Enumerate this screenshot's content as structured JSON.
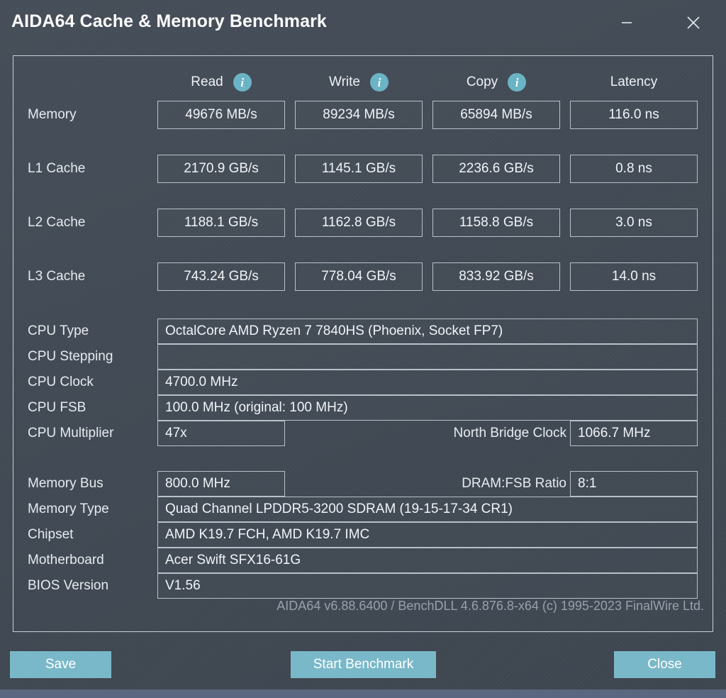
{
  "window": {
    "title": "AIDA64 Cache & Memory Benchmark",
    "minimize_label": "minimize",
    "close_label": "close"
  },
  "benchmark": {
    "columns": [
      {
        "label": "Read",
        "has_info": true
      },
      {
        "label": "Write",
        "has_info": true
      },
      {
        "label": "Copy",
        "has_info": true
      },
      {
        "label": "Latency",
        "has_info": false
      }
    ],
    "info_glyph": "i",
    "rows": [
      {
        "label": "Memory",
        "read": "49676 MB/s",
        "write": "89234 MB/s",
        "copy": "65894 MB/s",
        "latency": "116.0 ns"
      },
      {
        "label": "L1 Cache",
        "read": "2170.9 GB/s",
        "write": "1145.1 GB/s",
        "copy": "2236.6 GB/s",
        "latency": "0.8 ns"
      },
      {
        "label": "L2 Cache",
        "read": "1188.1 GB/s",
        "write": "1162.8 GB/s",
        "copy": "1158.8 GB/s",
        "latency": "3.0 ns"
      },
      {
        "label": "L3 Cache",
        "read": "743.24 GB/s",
        "write": "778.04 GB/s",
        "copy": "833.92 GB/s",
        "latency": "14.0 ns"
      }
    ]
  },
  "cpu_info": {
    "cpu_type_label": "CPU Type",
    "cpu_type_value": "OctalCore AMD Ryzen 7 7840HS  (Phoenix, Socket FP7)",
    "cpu_stepping_label": "CPU Stepping",
    "cpu_stepping_value": "",
    "cpu_clock_label": "CPU Clock",
    "cpu_clock_value": "4700.0 MHz",
    "cpu_fsb_label": "CPU FSB",
    "cpu_fsb_value": "100.0 MHz  (original: 100 MHz)",
    "cpu_multiplier_label": "CPU Multiplier",
    "cpu_multiplier_value": "47x",
    "north_bridge_label": "North Bridge Clock",
    "north_bridge_value": "1066.7 MHz"
  },
  "memory_info": {
    "memory_bus_label": "Memory Bus",
    "memory_bus_value": "800.0 MHz",
    "dram_fsb_label": "DRAM:FSB Ratio",
    "dram_fsb_value": "8:1",
    "memory_type_label": "Memory Type",
    "memory_type_value": "Quad Channel LPDDR5-3200 SDRAM  (19-15-17-34 CR1)",
    "chipset_label": "Chipset",
    "chipset_value": "AMD K19.7 FCH, AMD K19.7 IMC",
    "motherboard_label": "Motherboard",
    "motherboard_value": "Acer Swift SFX16-61G",
    "bios_label": "BIOS Version",
    "bios_value": "V1.56"
  },
  "footer": {
    "version_text": "AIDA64 v6.88.6400 / BenchDLL 4.6.876.8-x64  (c) 1995-2023 FinalWire Ltd.",
    "save_label": "Save",
    "start_label": "Start Benchmark",
    "close_label": "Close"
  },
  "colors": {
    "background": "#424a55",
    "accent": "#79b8c9",
    "info_icon": "#6bb4c6",
    "border": "#b9c0c9",
    "bottom_strip": "#5a6781"
  }
}
